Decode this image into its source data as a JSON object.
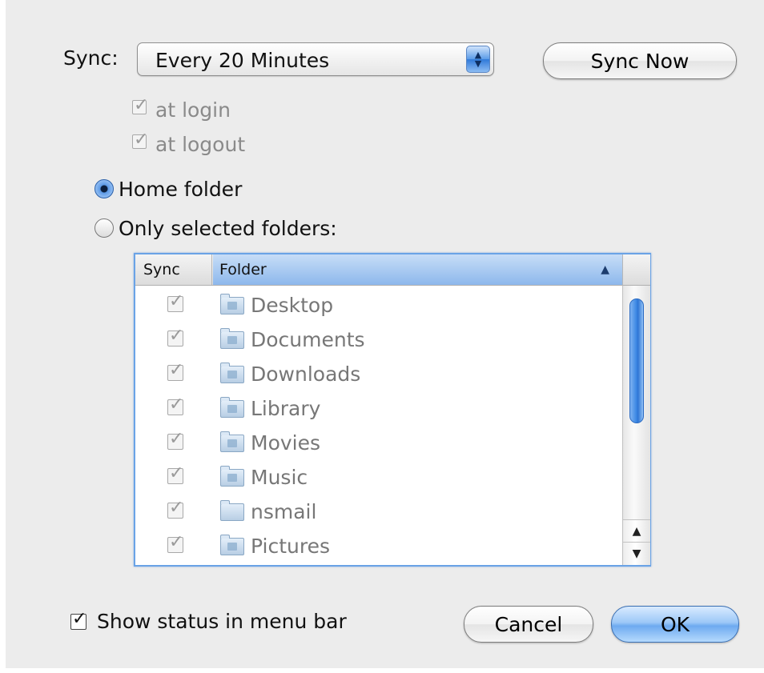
{
  "sync": {
    "label": "Sync:",
    "interval_value": "Every 20 Minutes",
    "sync_now_label": "Sync Now",
    "at_login_label": "at login",
    "at_logout_label": "at logout",
    "at_login_checked": true,
    "at_logout_checked": true
  },
  "scope": {
    "home_folder_label": "Home folder",
    "selected_folders_label": "Only selected folders:",
    "selected": "home_folder"
  },
  "table": {
    "columns": [
      "Sync",
      "Folder"
    ],
    "sort_indicator": "▲",
    "rows": [
      {
        "name": "Desktop",
        "checked": true
      },
      {
        "name": "Documents",
        "checked": true
      },
      {
        "name": "Downloads",
        "checked": true
      },
      {
        "name": "Library",
        "checked": true
      },
      {
        "name": "Movies",
        "checked": true
      },
      {
        "name": "Music",
        "checked": true
      },
      {
        "name": "nsmail",
        "checked": true
      },
      {
        "name": "Pictures",
        "checked": true
      }
    ]
  },
  "footer": {
    "show_status_label": "Show status in menu bar",
    "show_status_checked": true,
    "cancel_label": "Cancel",
    "ok_label": "OK"
  },
  "colors": {
    "dialog_background": "#ececec",
    "accent_blue": "#6aa3e6"
  }
}
